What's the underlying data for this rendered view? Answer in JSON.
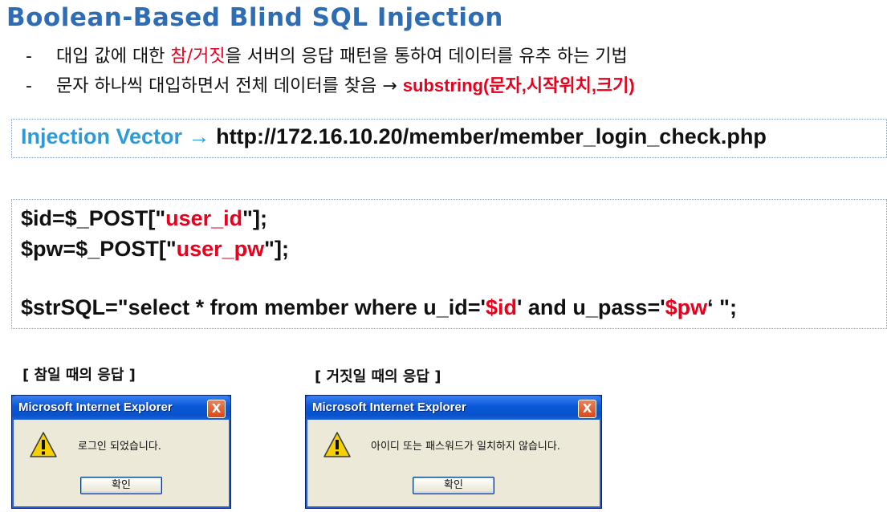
{
  "title": "Boolean-Based Blind SQL Injection",
  "bullets": [
    {
      "dash": "-",
      "before": "대입 값에 대한 ",
      "highlight": "참/거짓",
      "after": "을 서버의 응답 패턴을 통하여 데이터를 유추 하는 기법"
    },
    {
      "dash": "-",
      "before": "문자 하나씩 대입하면서 전체 데이터를 찾음 → ",
      "highlight": "substring(문자,시작위치,크기)"
    }
  ],
  "vector": {
    "label": "Injection Vector →",
    "url": "http://172.16.10.20/member/member_login_check.php"
  },
  "code": {
    "line1": {
      "pre": "$id=$_POST[\"",
      "var": "user_id",
      "post": "\"];"
    },
    "line2": {
      "pre": "$pw=$_POST[\"",
      "var": "user_pw",
      "post": "\"];"
    },
    "line3": {
      "pre": "$strSQL=\"select * from member where u_id='",
      "var1": "$id",
      "mid": "' and u_pass='",
      "var2": "$pw",
      "post": "‘ \";"
    }
  },
  "dialogs": [
    {
      "caption": "[ 참일 때의 응답 ]",
      "title": "Microsoft Internet Explorer",
      "close": "X",
      "message": "로그인 되었습니다.",
      "button": "확인"
    },
    {
      "caption": "[ 거짓일 때의 응답 ]",
      "title": "Microsoft Internet Explorer",
      "close": "X",
      "message": "아이디 또는 패스워드가 일치하지 않습니다.",
      "button": "확인"
    }
  ],
  "colors": {
    "title": "#2e6db4",
    "highlight": "#e8001c",
    "vector_label": "#2e9ad6"
  },
  "icons": {
    "warning": "warning-icon"
  }
}
